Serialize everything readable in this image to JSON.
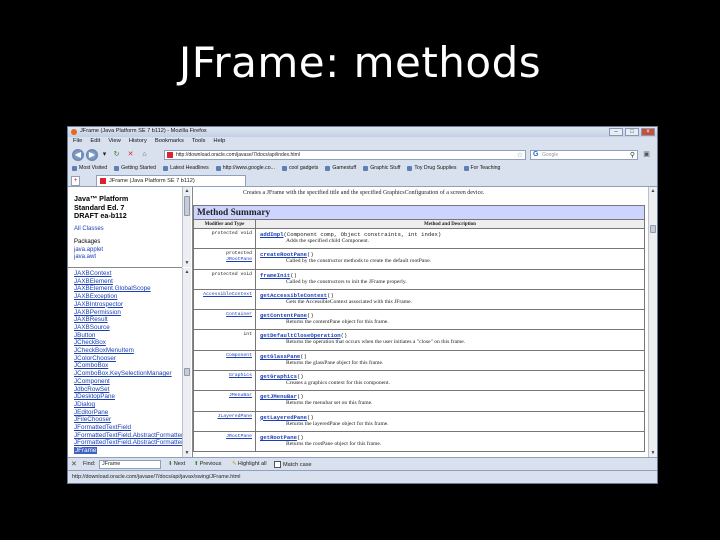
{
  "slide_title": "JFrame: methods",
  "browser": {
    "window_title": "JFrame (Java Platform SE 7 b112) - Mozilla Firefox",
    "menu": [
      "File",
      "Edit",
      "View",
      "History",
      "Bookmarks",
      "Tools",
      "Help"
    ],
    "url": "http://download.oracle.com/javase/7/docs/api/index.html",
    "search_placeholder": "Google",
    "bookmarks": [
      "Most Visited",
      "Getting Started",
      "Latest Headlines",
      "http://www.google.co...",
      "cool gadgets",
      "Gamestuff",
      "Graphic Stuff",
      "Toy Drug Supplies",
      "For Teaching"
    ],
    "tab_label": "JFrame (Java Platform SE 7 b112)",
    "find_label": "Find:",
    "find_value": "JFrame",
    "find_next": "Next",
    "find_previous": "Previous",
    "highlight_all": "Highlight all",
    "match_case": "Match case",
    "status_url": "http://download.oracle.com/javase/7/docs/api/javax/swing/JFrame.html"
  },
  "javadoc": {
    "brand_lines": [
      "Java™ Platform",
      "Standard Ed. 7",
      "DRAFT ea-b112"
    ],
    "all_classes": "All Classes",
    "packages_label": "Packages",
    "package_links": [
      "java.applet",
      "java.awt"
    ],
    "class_list": [
      "JAXBContext",
      "JAXBElement",
      "JAXBElement.GlobalScope",
      "JAXBException",
      "JAXBIntrospector",
      "JAXBPermission",
      "JAXBResult",
      "JAXBSource",
      "JButton",
      "JCheckBox",
      "JCheckBoxMenuItem",
      "JColorChooser",
      "JComboBox",
      "JComboBox.KeySelectionManager",
      "JComponent",
      "JdbcRowSet",
      "JDesktopPane",
      "JDialog",
      "JEditorPane",
      "JFileChooser",
      "JFormattedTextField",
      "JFormattedTextField.AbstractFormatter",
      "JFormattedTextField.AbstractFormatterFactory",
      "JFrame"
    ],
    "selected_class": "JFrame",
    "cut_off_text": "Creates a JFrame with the specified title and the specified GraphicsConfiguration of a screen device.",
    "method_summary_title": "Method Summary",
    "col_modifier": "Modifier and Type",
    "col_method": "Method and Description",
    "methods": [
      {
        "modifier": "protected void",
        "modifier_link": "",
        "name": "addImpl",
        "params": "(Component comp, Object constraints, int index)",
        "description": "Adds the specified child Component."
      },
      {
        "modifier": "protected",
        "modifier_link": "JRootPane",
        "name": "createRootPane",
        "params": "()",
        "description": "Called by the constructor methods to create the default rootPane."
      },
      {
        "modifier": "protected void",
        "modifier_link": "",
        "name": "frameInit",
        "params": "()",
        "description": "Called by the constructors to init the JFrame properly."
      },
      {
        "modifier": "",
        "modifier_link": "AccessibleContext",
        "name": "getAccessibleContext",
        "params": "()",
        "description": "Gets the AccessibleContext associated with this JFrame."
      },
      {
        "modifier": "",
        "modifier_link": "Container",
        "name": "getContentPane",
        "params": "()",
        "description": "Returns the contentPane object for this frame."
      },
      {
        "modifier": "int",
        "modifier_link": "",
        "name": "getDefaultCloseOperation",
        "params": "()",
        "description": "Returns the operation that occurs when the user initiates a \"close\" on this frame."
      },
      {
        "modifier": "",
        "modifier_link": "Component",
        "name": "getGlassPane",
        "params": "()",
        "description": "Returns the glassPane object for this frame."
      },
      {
        "modifier": "",
        "modifier_link": "Graphics",
        "name": "getGraphics",
        "params": "()",
        "description": "Creates a graphics context for this component."
      },
      {
        "modifier": "",
        "modifier_link": "JMenuBar",
        "name": "getJMenuBar",
        "params": "()",
        "description": "Returns the menubar set on this frame."
      },
      {
        "modifier": "",
        "modifier_link": "JLayeredPane",
        "name": "getLayeredPane",
        "params": "()",
        "description": "Returns the layeredPane object for this frame."
      },
      {
        "modifier": "",
        "modifier_link": "JRootPane",
        "name": "getRootPane",
        "params": "()",
        "description": "Returns the rootPane object for this frame."
      }
    ]
  }
}
